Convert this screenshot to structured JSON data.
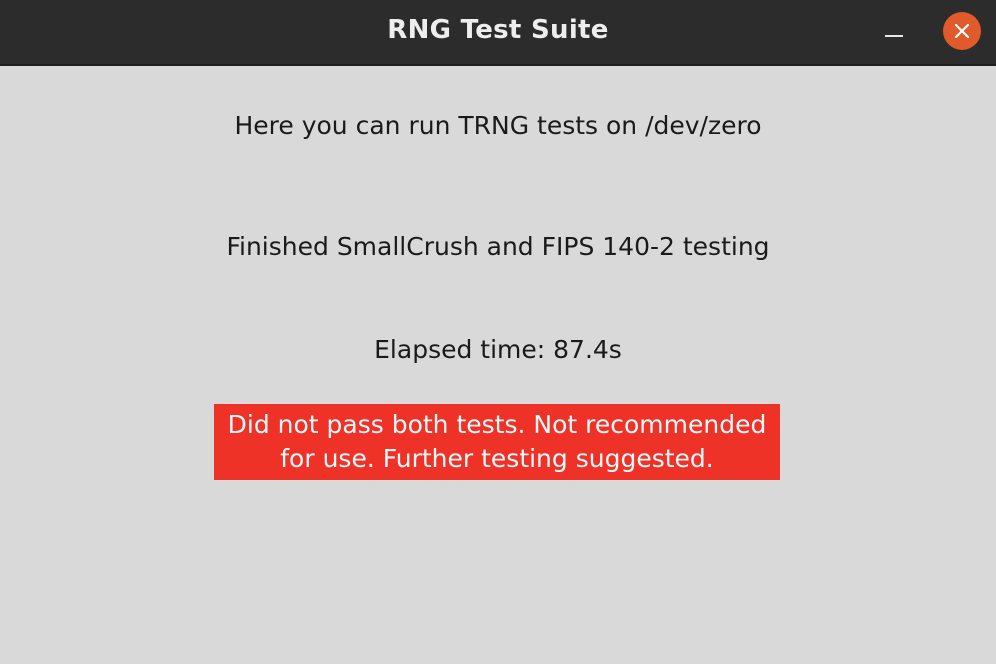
{
  "window": {
    "title": "RNG Test Suite",
    "minimize_icon": "minimize-icon",
    "close_icon": "close-icon",
    "close_color": "#e05a2b"
  },
  "main": {
    "intro_text": "Here you can run TRNG tests on /dev/zero",
    "status_text": "Finished SmallCrush and FIPS 140-2 testing",
    "elapsed_text": "Elapsed time: 87.4s",
    "result_line1": "Did not pass both tests. Not recommended",
    "result_line2": "for use. Further testing suggested.",
    "result_color": "#ee3228"
  }
}
